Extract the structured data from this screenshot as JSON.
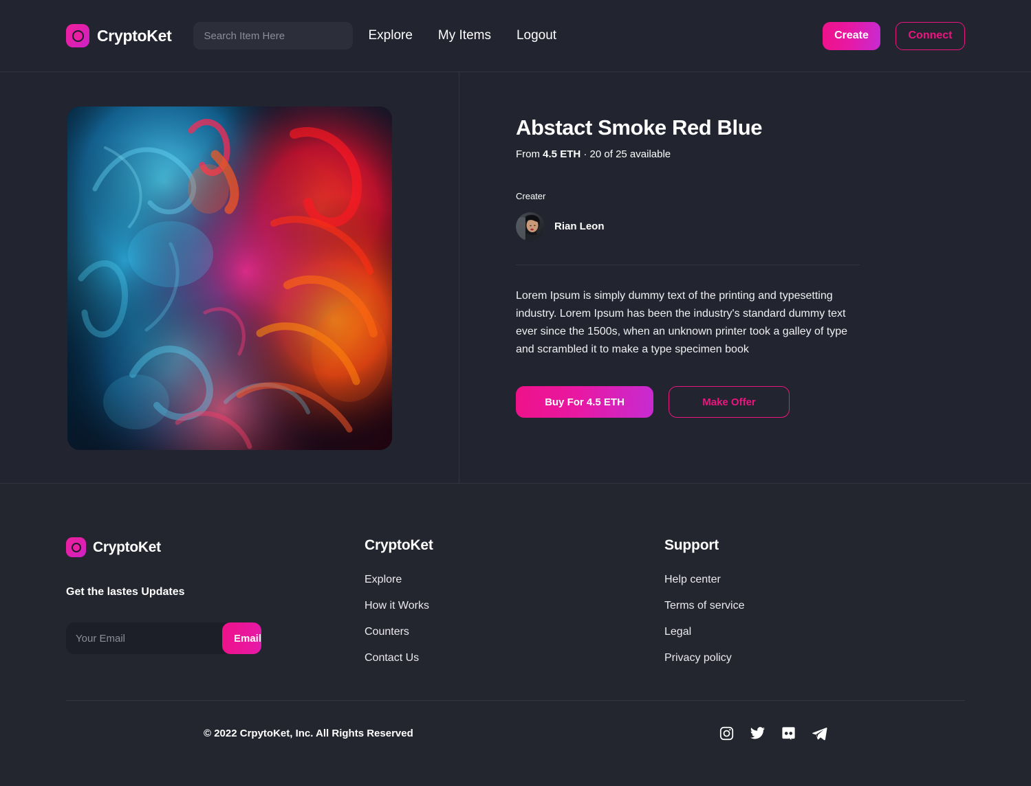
{
  "header": {
    "brand_name": "CryptoKet",
    "logo_icon": "cryptoket-logo-icon",
    "search": {
      "placeholder": "Search Item Here",
      "value": "",
      "icon": "search-icon"
    },
    "nav": [
      {
        "label": "Explore"
      },
      {
        "label": "My Items"
      },
      {
        "label": "Logout"
      }
    ],
    "create_label": "Create",
    "connect_label": "Connect"
  },
  "item": {
    "image_alt": "Abstract red and blue smoke ink artwork",
    "title": "Abstact Smoke Red Blue",
    "price_prefix": "From",
    "price": "4.5 ETH",
    "availability": "20 of 25 available",
    "separator": "·",
    "creator_label": "Creater",
    "creator_name": "Rian Leon",
    "description": "Lorem Ipsum is simply dummy text of the printing and typesetting industry. Lorem Ipsum has been the industry's standard dummy text ever since the 1500s, when an unknown printer took a galley of type and scrambled it to make a type specimen book",
    "buy_label": "Buy For 4.5 ETH",
    "offer_label": "Make Offer"
  },
  "footer": {
    "brand_name": "CryptoKet",
    "newsletter_title": "Get the lastes Updates",
    "email_placeholder": "Your Email",
    "email_value": "",
    "email_button": "Email Me!",
    "columns": [
      {
        "heading": "CryptoKet",
        "links": [
          {
            "label": "Explore"
          },
          {
            "label": "How it Works"
          },
          {
            "label": "Counters"
          },
          {
            "label": "Contact Us"
          }
        ]
      },
      {
        "heading": "Support",
        "links": [
          {
            "label": "Help center"
          },
          {
            "label": "Terms of service"
          },
          {
            "label": "Legal"
          },
          {
            "label": "Privacy policy"
          }
        ]
      }
    ],
    "copyright": "© 2022 CrpytoKet, Inc. All Rights Reserved",
    "socials": [
      {
        "name": "instagram-icon"
      },
      {
        "name": "twitter-icon"
      },
      {
        "name": "discord-icon"
      },
      {
        "name": "telegram-icon"
      }
    ]
  },
  "colors": {
    "background": "#22242f",
    "footer_background": "#24262f",
    "accent_pink": "#ec1580",
    "accent_purple": "#c72bd2",
    "border": "#32343f",
    "input_background": "#2c2e3a",
    "muted_text": "#8b8d9a"
  }
}
